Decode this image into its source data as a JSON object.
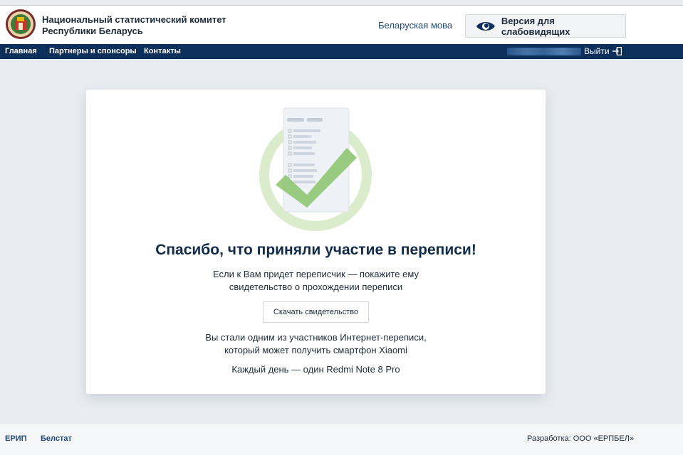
{
  "header": {
    "org_line1": "Национальный статистический комитет",
    "org_line2": "Республики Беларусь",
    "lang_link": "Беларуская мова",
    "vision_button": "Версия для слабовидящих"
  },
  "nav": {
    "items": [
      "Главная",
      "Партнеры и спонсоры",
      "Контакты"
    ],
    "logout": "Выйти"
  },
  "card": {
    "title": "Спасибо, что приняли участие в переписи!",
    "text_line1": "Если к Вам придет переписчик — покажите ему",
    "text_line2": "свидетельство о прохождении переписи",
    "download_button": "Скачать свидетельство",
    "prize_line1": "Вы стали одним из участников Интернет-переписи,",
    "prize_line2": "который может получить смартфон Xiaomi",
    "daily": "Каждый день — один Redmi Note 8 Pro"
  },
  "footer": {
    "link1": "ЕРИП",
    "link2": "Белстат",
    "developer": "Разработка: ООО «ЕРПБЕЛ»"
  },
  "colors": {
    "navbar": "#0d2f5c",
    "title": "#102a4c",
    "link": "#1f4a78",
    "check": "#8cc46f"
  }
}
